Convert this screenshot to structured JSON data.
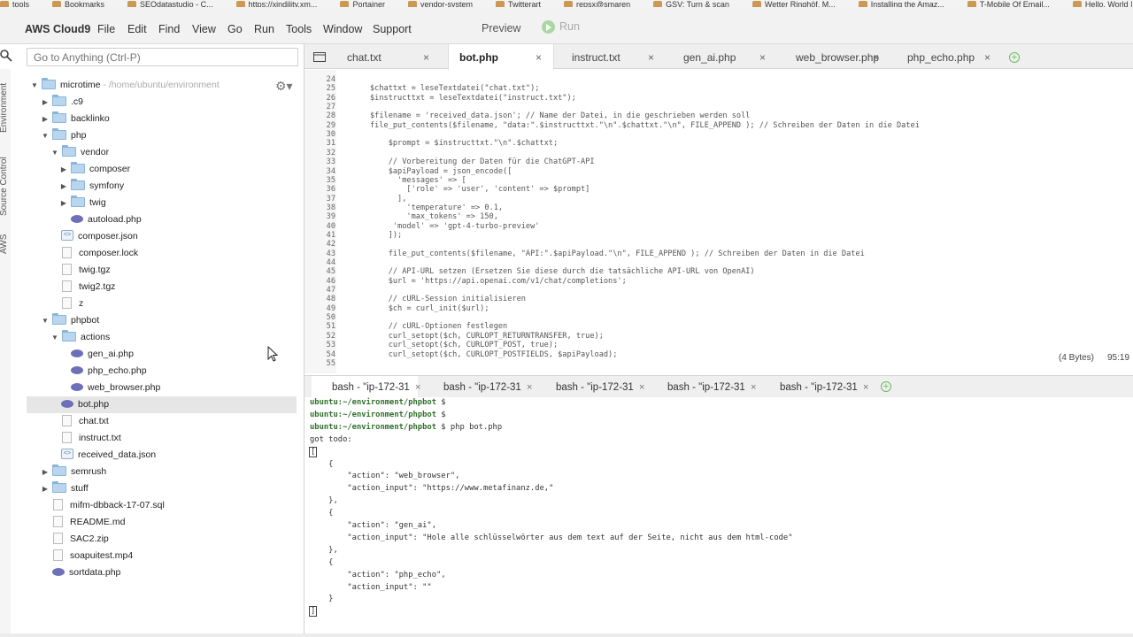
{
  "bookmarks": [
    "tools",
    "Bookmarks",
    "SEOdatastudio - C...",
    "https://xindility.xm...",
    "Portainer",
    "vendor-system",
    "Twitterart",
    "repsx@smaren",
    "GSV: Turn & scan",
    "Wetter Ringhöf, M...",
    "Installing the Amaz...",
    "T-Mobile Of Email...",
    "Hello, World | Amaz..."
  ],
  "menubar": {
    "brand": "AWS Cloud9",
    "items": [
      "File",
      "Edit",
      "Find",
      "View",
      "Go",
      "Run",
      "Tools",
      "Window",
      "Support"
    ],
    "preview": "Preview",
    "run": "Run"
  },
  "sidetabs": [
    "Environment",
    "Source Control",
    "AWS"
  ],
  "goto": {
    "placeholder": "Go to Anything (Ctrl-P)"
  },
  "tree": {
    "root": {
      "name": "microtime",
      "path": " - /home/ubuntu/environment"
    },
    "items": [
      {
        "name": ".c9"
      },
      {
        "name": "backlinko"
      },
      {
        "name": "php"
      },
      {
        "name": "vendor"
      },
      {
        "name": "composer"
      },
      {
        "name": "symfony"
      },
      {
        "name": "twig"
      },
      {
        "name": "autoload.php"
      },
      {
        "name": "composer.json"
      },
      {
        "name": "composer.lock"
      },
      {
        "name": "twig.tgz"
      },
      {
        "name": "twig2.tgz"
      },
      {
        "name": "z"
      },
      {
        "name": "phpbot"
      },
      {
        "name": "actions"
      },
      {
        "name": "gen_ai.php"
      },
      {
        "name": "php_echo.php"
      },
      {
        "name": "web_browser.php"
      },
      {
        "name": "bot.php"
      },
      {
        "name": "chat.txt"
      },
      {
        "name": "instruct.txt"
      },
      {
        "name": "received_data.json"
      },
      {
        "name": "semrush"
      },
      {
        "name": "stuff"
      },
      {
        "name": "mifm-dbback-17-07.sql"
      },
      {
        "name": "README.md"
      },
      {
        "name": "SAC2.zip"
      },
      {
        "name": "soapuitest.mp4"
      },
      {
        "name": "sortdata.php"
      }
    ]
  },
  "tabs": [
    "chat.txt",
    "bot.php",
    "instruct.txt",
    "gen_ai.php",
    "web_browser.php",
    "php_echo.php"
  ],
  "close_glyph": "×",
  "plus_glyph": "+",
  "editor": {
    "lines": [
      {
        "n": "24",
        "t": ""
      },
      {
        "n": "25",
        "t": "$chattxt = leseTextdatei(\"chat.txt\");"
      },
      {
        "n": "26",
        "t": "$instructtxt = leseTextdatei(\"instruct.txt\");"
      },
      {
        "n": "27",
        "t": ""
      },
      {
        "n": "28",
        "t": "$filename = 'received_data.json'; // Name der Datei, in die geschrieben werden soll"
      },
      {
        "n": "29",
        "t": "file_put_contents($filename, \"data:\".$instructtxt.\"\\n\".$chattxt.\"\\n\", FILE_APPEND ); // Schreiben der Daten in die Datei"
      },
      {
        "n": "30",
        "t": ""
      },
      {
        "n": "31",
        "t": "    $prompt = $instructtxt.\"\\n\".$chattxt;"
      },
      {
        "n": "32",
        "t": ""
      },
      {
        "n": "33",
        "t": "    // Vorbereitung der Daten für die ChatGPT-API"
      },
      {
        "n": "34",
        "t": "    $apiPayload = json_encode(["
      },
      {
        "n": "35",
        "t": "      'messages' => ["
      },
      {
        "n": "36",
        "t": "        ['role' => 'user', 'content' => $prompt]"
      },
      {
        "n": "37",
        "t": "      ],"
      },
      {
        "n": "38",
        "t": "        'temperature' => 0.1,"
      },
      {
        "n": "39",
        "t": "        'max_tokens' => 150,"
      },
      {
        "n": "40",
        "t": "     'model' => 'gpt-4-turbo-preview'"
      },
      {
        "n": "41",
        "t": "    ]);"
      },
      {
        "n": "42",
        "t": ""
      },
      {
        "n": "43",
        "t": "    file_put_contents($filename, \"API:\".$apiPayload.\"\\n\", FILE_APPEND ); // Schreiben der Daten in die Datei"
      },
      {
        "n": "44",
        "t": ""
      },
      {
        "n": "45",
        "t": "    // API-URL setzen (Ersetzen Sie diese durch die tatsächliche API-URL von OpenAI)"
      },
      {
        "n": "46",
        "t": "    $url = 'https://api.openai.com/v1/chat/completions';"
      },
      {
        "n": "47",
        "t": ""
      },
      {
        "n": "48",
        "t": "    // cURL-Session initialisieren"
      },
      {
        "n": "49",
        "t": "    $ch = curl_init($url);"
      },
      {
        "n": "50",
        "t": ""
      },
      {
        "n": "51",
        "t": "    // cURL-Optionen festlegen"
      },
      {
        "n": "52",
        "t": "    curl_setopt($ch, CURLOPT_RETURNTRANSFER, true);"
      },
      {
        "n": "53",
        "t": "    curl_setopt($ch, CURLOPT_POST, true);"
      },
      {
        "n": "54",
        "t": "    curl_setopt($ch, CURLOPT_POSTFIELDS, $apiPayload);"
      },
      {
        "n": "55",
        "t": ""
      }
    ],
    "status_bytes": "(4 Bytes)",
    "status_pos": "95:19"
  },
  "terminal": {
    "tabs": [
      "bash - \"ip-172-31",
      "bash - \"ip-172-31",
      "bash - \"ip-172-31",
      "bash - \"ip-172-31",
      "bash - \"ip-172-31"
    ],
    "lines": [
      {
        "prompt": "ubuntu:~/environment/phpbot",
        "cmd": " $ "
      },
      {
        "prompt": "ubuntu:~/environment/phpbot",
        "cmd": " $ "
      },
      {
        "prompt": "ubuntu:~/environment/phpbot",
        "cmd": " $ php bot.php"
      },
      {
        "prompt": "",
        "cmd": "got todo:"
      },
      {
        "prompt": "",
        "cmd": "["
      },
      {
        "prompt": "",
        "cmd": "    {"
      },
      {
        "prompt": "",
        "cmd": "        \"action\": \"web_browser\","
      },
      {
        "prompt": "",
        "cmd": "        \"action_input\": \"https://www.metafinanz.de,\""
      },
      {
        "prompt": "",
        "cmd": "    },"
      },
      {
        "prompt": "",
        "cmd": "    {"
      },
      {
        "prompt": "",
        "cmd": "        \"action\": \"gen_ai\","
      },
      {
        "prompt": "",
        "cmd": "        \"action_input\": \"Hole alle schlüsselwörter aus dem text auf der Seite, nicht aus dem html-code\""
      },
      {
        "prompt": "",
        "cmd": "    },"
      },
      {
        "prompt": "",
        "cmd": "    {"
      },
      {
        "prompt": "",
        "cmd": "        \"action\": \"php_echo\","
      },
      {
        "prompt": "",
        "cmd": "        \"action_input\": \"\""
      },
      {
        "prompt": "",
        "cmd": "    }"
      },
      {
        "prompt": "",
        "cmd": "]"
      }
    ]
  }
}
